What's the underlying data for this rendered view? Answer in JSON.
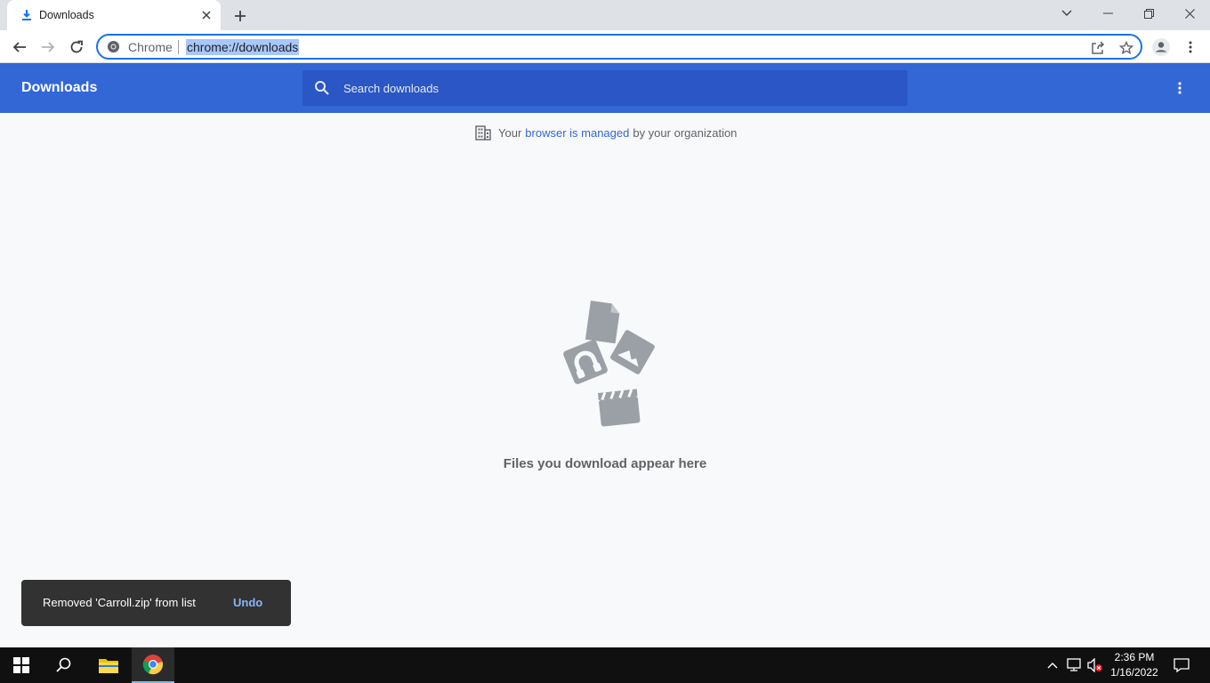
{
  "tab": {
    "title": "Downloads"
  },
  "toolbar": {
    "site_chip": "Chrome",
    "url": "chrome://downloads"
  },
  "downloads": {
    "title": "Downloads",
    "search_placeholder": "Search downloads"
  },
  "managed": {
    "prefix": "Your",
    "link": "browser is managed",
    "suffix": "by your organization"
  },
  "empty": {
    "text": "Files you download appear here"
  },
  "toast": {
    "message": "Removed 'Carroll.zip' from list",
    "action": "Undo"
  },
  "taskbar": {
    "time": "2:36 PM",
    "date": "1/16/2022"
  },
  "colors": {
    "header": "#3367d6",
    "search": "#2a56c6",
    "accent": "#1a73e8"
  }
}
